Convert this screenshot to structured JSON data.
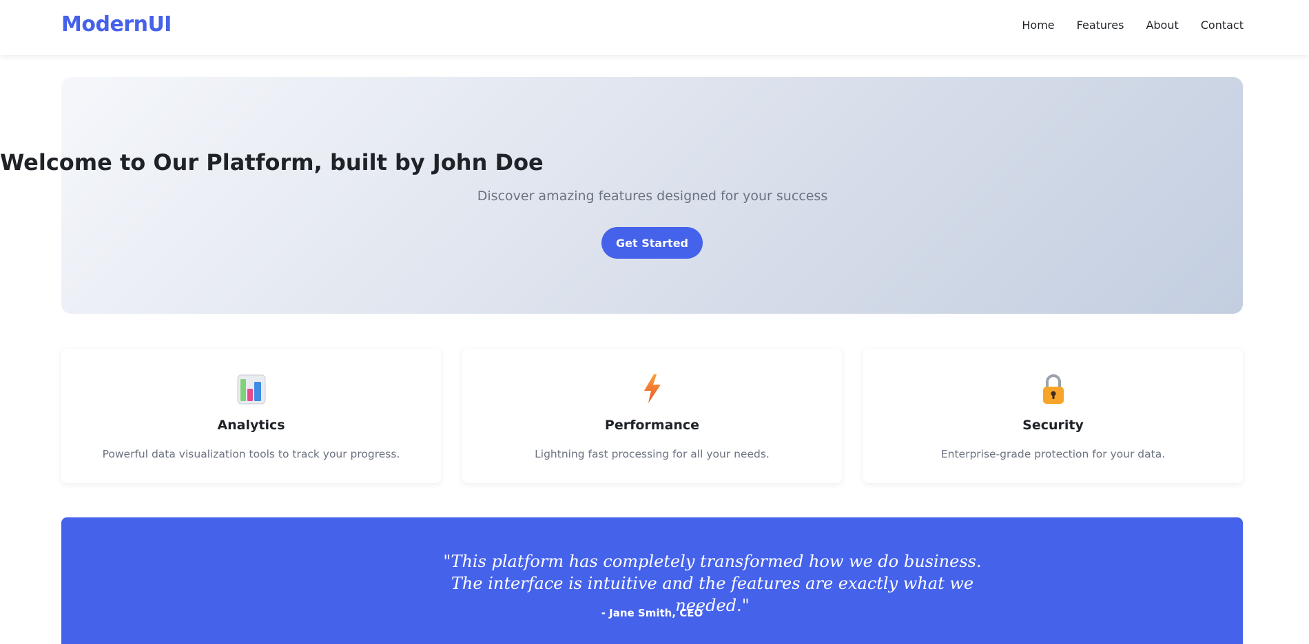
{
  "header": {
    "logo": "ModernUI",
    "nav": [
      "Home",
      "Features",
      "About",
      "Contact"
    ]
  },
  "hero": {
    "title": "Welcome to Our Platform, built by John Doe",
    "subtitle": "Discover amazing features designed for your success",
    "cta": "Get Started"
  },
  "features": [
    {
      "icon": "bar-chart-icon",
      "title": "Analytics",
      "description": "Powerful data visualization tools to track your progress."
    },
    {
      "icon": "lightning-icon",
      "title": "Performance",
      "description": "Lightning fast processing for all your needs."
    },
    {
      "icon": "lock-icon",
      "title": "Security",
      "description": "Enterprise-grade protection for your data."
    }
  ],
  "testimonial": {
    "quote": "\"This platform has completely transformed how we do business. The interface is intuitive and the features are exactly what we needed.\"",
    "author": "- Jane Smith, CEO"
  },
  "colors": {
    "brand": "#4562ea",
    "hero_gradient_start": "#f5f7fb",
    "hero_gradient_end": "#c3cee0"
  }
}
